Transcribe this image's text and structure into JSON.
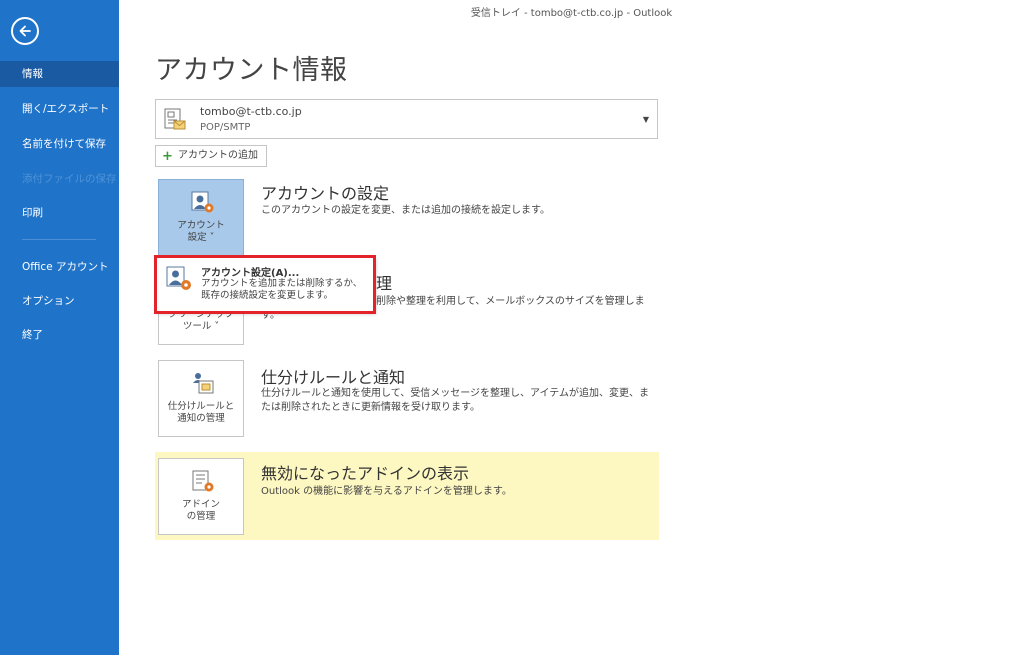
{
  "window": {
    "title": "受信トレイ - tombo@t-ctb.co.jp - Outlook"
  },
  "sidebar": {
    "items": [
      {
        "label": "情報"
      },
      {
        "label": "開く/エクスポート"
      },
      {
        "label": "名前を付けて保存"
      },
      {
        "label": "添付ファイルの保存"
      },
      {
        "label": "印刷"
      },
      {
        "label": "Office アカウント"
      },
      {
        "label": "オプション"
      },
      {
        "label": "終了"
      }
    ]
  },
  "page": {
    "title": "アカウント情報"
  },
  "account": {
    "email": "tombo@t-ctb.co.jp",
    "type": "POP/SMTP",
    "add_label": "アカウントの追加"
  },
  "sections": {
    "account_settings": {
      "tile_label_1": "アカウント",
      "tile_label_2": "設定 ˅",
      "title": "アカウントの設定",
      "desc": "このアカウントの設定を変更、または追加の接続を設定します。"
    },
    "mailbox_cleanup": {
      "tile_label_1": "クリーンアップ",
      "tile_label_2": "ツール ˅",
      "title_suffix": "理",
      "desc_1": "削除や整理を利用して、メールボックスのサイズを管理しま",
      "desc_2": "す。"
    },
    "rules": {
      "tile_label_1": "仕分けルールと",
      "tile_label_2": "通知の管理",
      "title": "仕分けルールと通知",
      "desc_1": "仕分けルールと通知を使用して、受信メッセージを整理し、アイテムが追加、変更、ま",
      "desc_2": "たは削除されたときに更新情報を受け取ります。"
    },
    "addins": {
      "tile_label_1": "アドイン",
      "tile_label_2": "の管理",
      "title": "無効になったアドインの表示",
      "desc": "Outlook の機能に影響を与えるアドインを管理します。"
    }
  },
  "popup": {
    "title": "アカウント設定(A)...",
    "desc_1": "アカウントを追加または削除するか、",
    "desc_2": "既存の接続設定を変更します。"
  },
  "colors": {
    "sidebar": "#1f73c9",
    "sidebar_active": "#195aa3",
    "addin_bg": "#fdf7c1",
    "highlight": "#e3222a"
  }
}
